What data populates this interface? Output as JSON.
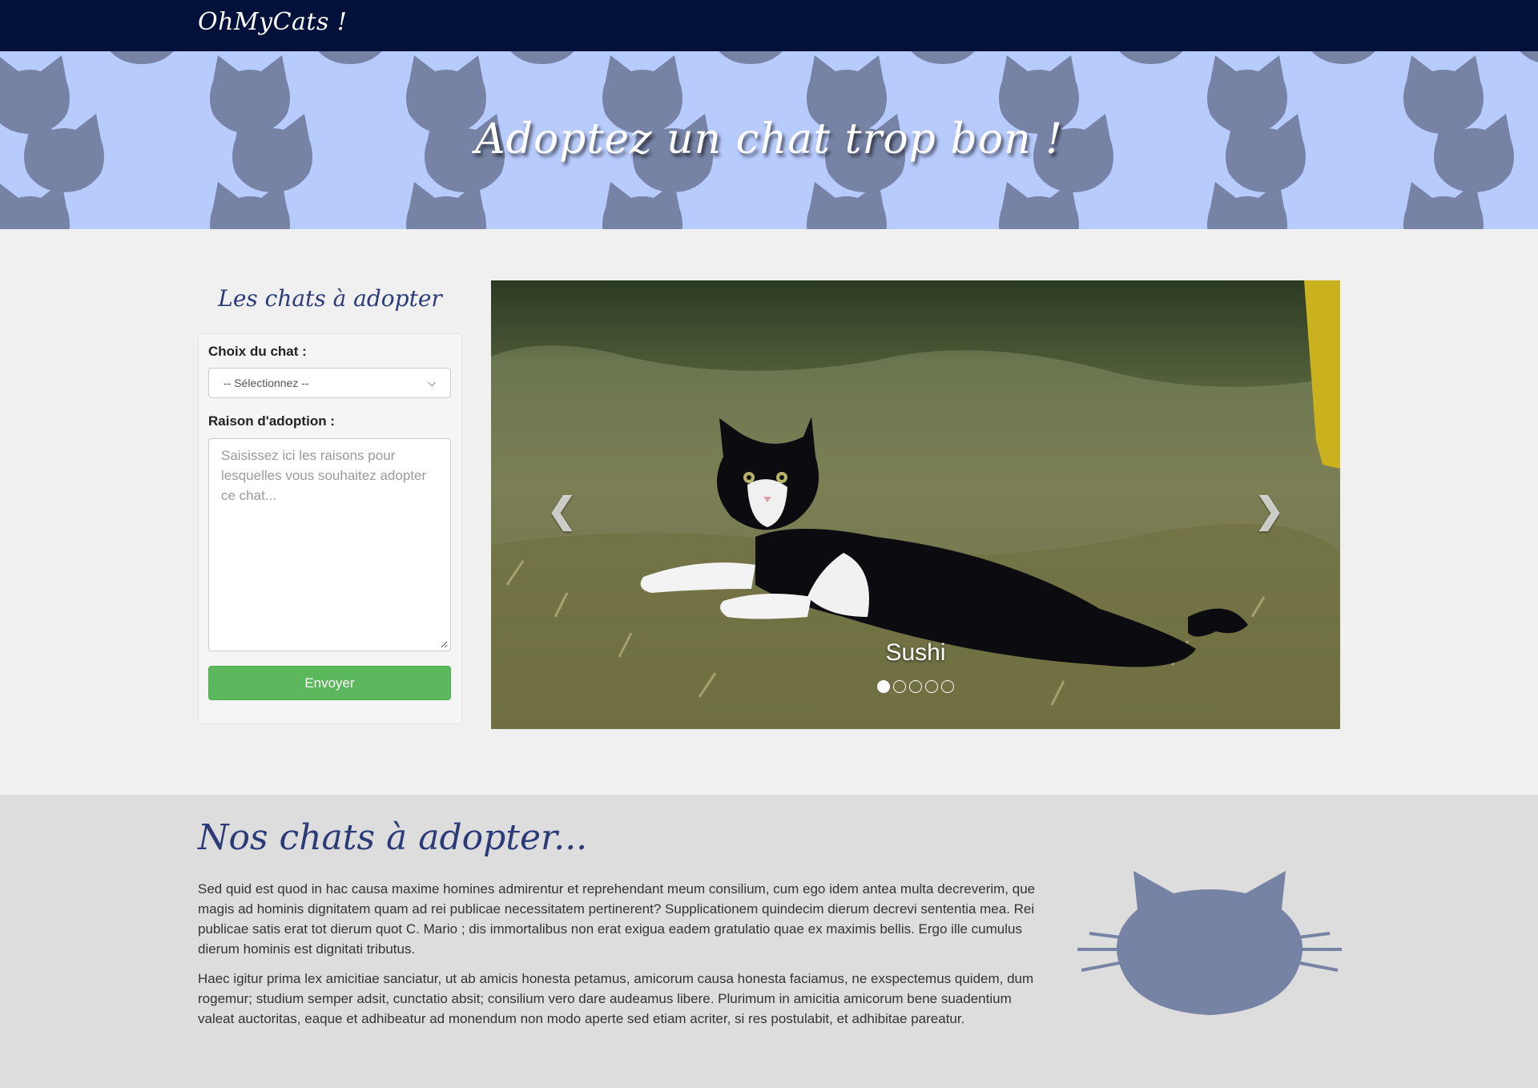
{
  "navbar": {
    "brand": "OhMyCats !"
  },
  "hero": {
    "title": "Adoptez un chat trop bon !"
  },
  "adoption_form": {
    "title": "Les chats à adopter",
    "cat_choice_label": "Choix du chat :",
    "cat_select_value": "-- Sélectionnez --",
    "reason_label": "Raison d'adoption :",
    "reason_placeholder": "Saisissez ici les raisons pour lesquelles vous souhaitez adopter ce chat...",
    "submit_label": "Envoyer"
  },
  "carousel": {
    "caption": "Sushi",
    "slide_count": 5,
    "active_index": 0,
    "prev_icon": "chevron-left-icon",
    "next_icon": "chevron-right-icon"
  },
  "about": {
    "title": "Nos chats à adopter...",
    "paragraph1": "Sed quid est quod in hac causa maxime homines admirentur et reprehendant meum consilium, cum ego idem antea multa decreverim, que magis ad hominis dignitatem quam ad rei publicae necessitatem pertinerent? Supplicationem quindecim dierum decrevi sententia mea. Rei publicae satis erat tot dierum quot C. Mario ; dis immortalibus non erat exigua eadem gratulatio quae ex maximis bellis. Ergo ille cumulus dierum hominis est dignitati tributus.",
    "paragraph2": "Haec igitur prima lex amicitiae sanciatur, ut ab amicis honesta petamus, amicorum causa honesta faciamus, ne exspectemus quidem, dum rogemur; studium semper adsit, cunctatio absit; consilium vero dare audeamus libere. Plurimum in amicitia amicorum bene suadentium valeat auctoritas, eaque et adhibeatur ad monendum non modo aperte sed etiam acriter, si res postulabit, et adhibitae pareatur."
  },
  "colors": {
    "navbar": "#02113a",
    "hero_bg": "#b8cbfd",
    "cat_silhouette": "#7683a5",
    "title_blue": "#2b3a78",
    "button_green": "#5cb85c"
  }
}
